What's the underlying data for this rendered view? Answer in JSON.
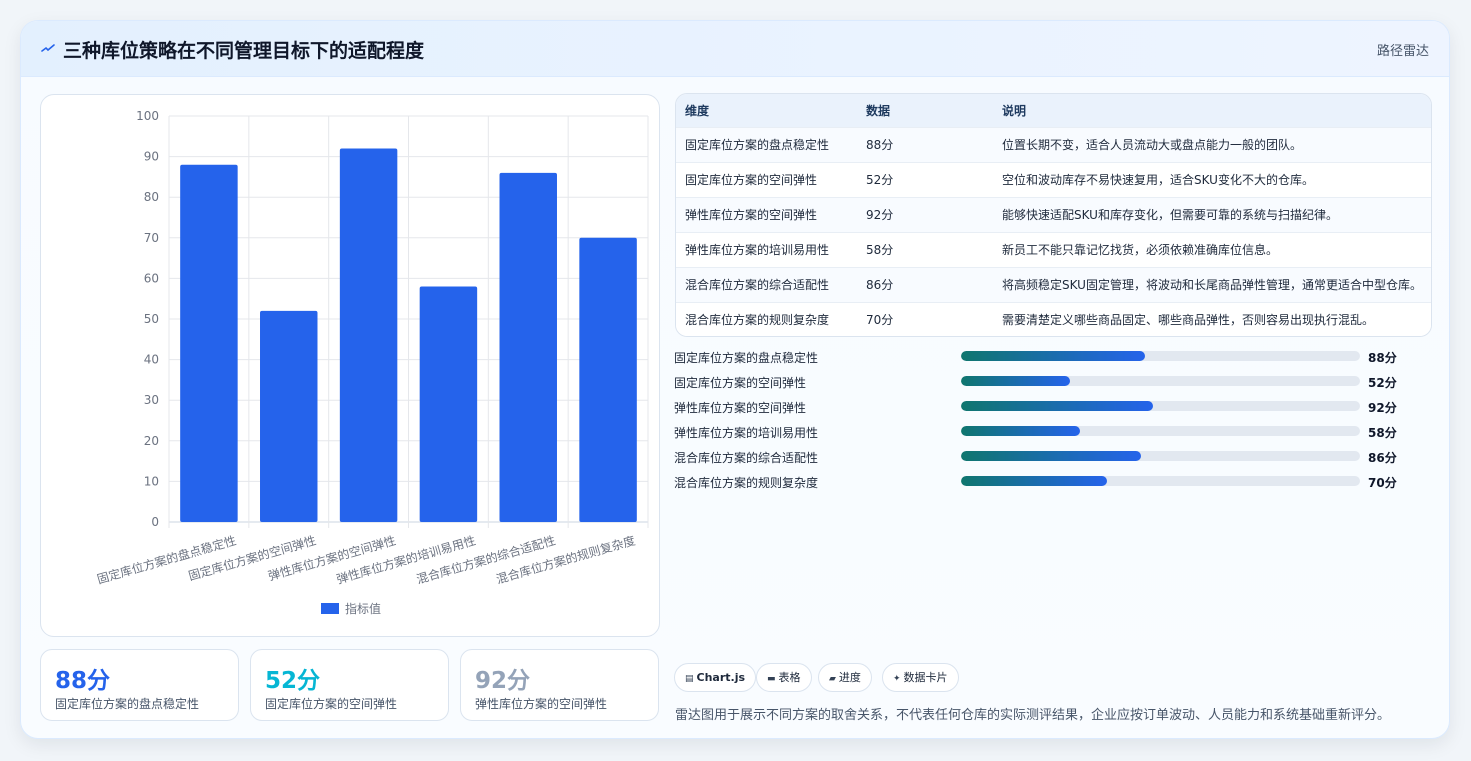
{
  "header": {
    "title": "三种库位策略在不同管理目标下的适配程度",
    "link": "路径雷达",
    "icon": "spark-icon"
  },
  "chart_data": {
    "type": "bar",
    "categories": [
      "固定库位方案的盘点稳定性",
      "固定库位方案的空间弹性",
      "弹性库位方案的空间弹性",
      "弹性库位方案的培训易用性",
      "混合库位方案的综合适配性",
      "混合库位方案的规则复杂度"
    ],
    "series": [
      {
        "name": "指标值",
        "values": [
          88,
          52,
          92,
          58,
          86,
          70
        ]
      }
    ],
    "ylim": [
      0,
      100
    ],
    "yticks": [
      0,
      10,
      20,
      30,
      40,
      50,
      60,
      70,
      80,
      90,
      100
    ],
    "legend": "bottom",
    "grid": true,
    "color": "#2563eb"
  },
  "kpis": [
    {
      "value": "88分",
      "label": "固定库位方案的盘点稳定性",
      "color": "#2563eb"
    },
    {
      "value": "52分",
      "label": "固定库位方案的空间弹性",
      "color": "#06b6d4"
    },
    {
      "value": "92分",
      "label": "弹性库位方案的空间弹性",
      "color": "#94a3b8"
    }
  ],
  "table": {
    "headers": [
      "维度",
      "数据",
      "说明"
    ],
    "rows": [
      [
        "固定库位方案的盘点稳定性",
        "88分",
        "位置长期不变，适合人员流动大或盘点能力一般的团队。"
      ],
      [
        "固定库位方案的空间弹性",
        "52分",
        "空位和波动库存不易快速复用，适合SKU变化不大的仓库。"
      ],
      [
        "弹性库位方案的空间弹性",
        "92分",
        "能够快速适配SKU和库存变化，但需要可靠的系统与扫描纪律。"
      ],
      [
        "弹性库位方案的培训易用性",
        "58分",
        "新员工不能只靠记忆找货，必须依赖准确库位信息。"
      ],
      [
        "混合库位方案的综合适配性",
        "86分",
        "将高频稳定SKU固定管理，将波动和长尾商品弹性管理，通常更适合中型仓库。"
      ],
      [
        "混合库位方案的规则复杂度",
        "70分",
        "需要清楚定义哪些商品固定、哪些商品弹性，否则容易出现执行混乱。"
      ]
    ]
  },
  "progress": [
    {
      "label": "固定库位方案的盘点稳定性",
      "value_text": "88分",
      "fraction": 0.46
    },
    {
      "label": "固定库位方案的空间弹性",
      "value_text": "52分",
      "fraction": 0.273
    },
    {
      "label": "弹性库位方案的空间弹性",
      "value_text": "92分",
      "fraction": 0.48
    },
    {
      "label": "弹性库位方案的培训易用性",
      "value_text": "58分",
      "fraction": 0.298
    },
    {
      "label": "混合库位方案的综合适配性",
      "value_text": "86分",
      "fraction": 0.45
    },
    {
      "label": "混合库位方案的规则复杂度",
      "value_text": "70分",
      "fraction": 0.365
    }
  ],
  "chips": [
    {
      "icon": "▤",
      "label": "Chart.js",
      "bold": true
    },
    {
      "icon": "▬",
      "label": "表格"
    },
    {
      "icon": "▰",
      "label": "进度"
    },
    {
      "icon": "✦",
      "label": "数据卡片"
    }
  ],
  "footnote": "雷达图用于展示不同方案的取舍关系，不代表任何仓库的实际测评结果，企业应按订单波动、人员能力和系统基础重新评分。"
}
